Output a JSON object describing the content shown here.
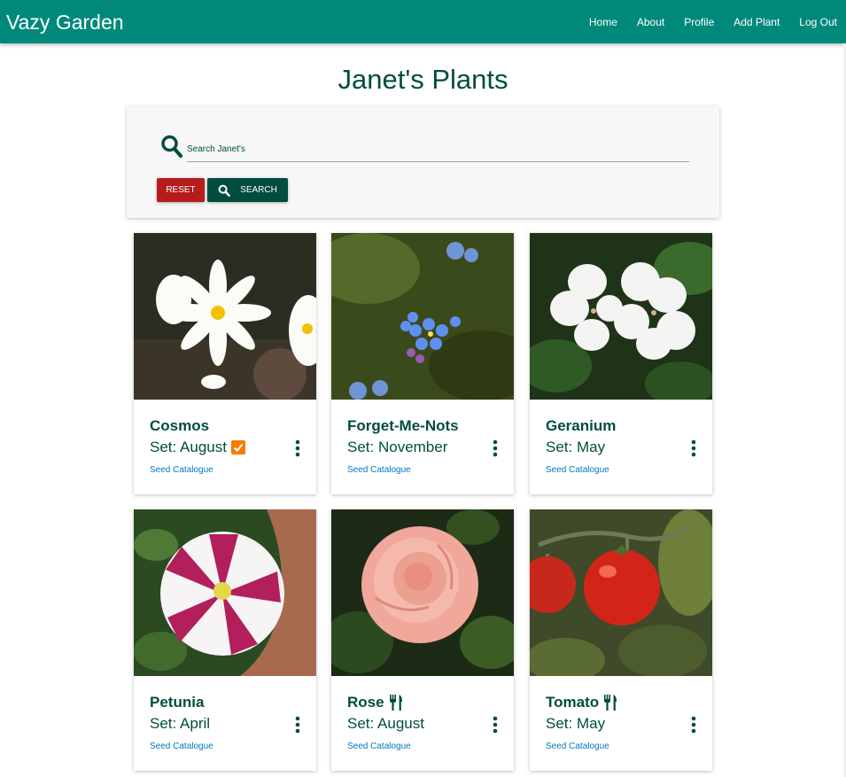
{
  "navbar": {
    "brand": "Vazy Garden",
    "links": [
      "Home",
      "About",
      "Profile",
      "Add Plant",
      "Log Out"
    ],
    "background": "#00897b"
  },
  "page": {
    "title": "Janet's Plants"
  },
  "search": {
    "placeholder": "Search Janet's",
    "value": "",
    "reset_label": "Reset",
    "search_label": "Search"
  },
  "colors": {
    "primary_dark": "#004d40",
    "danger": "#b71c1c",
    "link": "#0277bd",
    "check_accent": "#f57c00"
  },
  "plants": [
    {
      "name": "Cosmos",
      "set": "Set: August",
      "checked": true,
      "edible": false,
      "link": "Seed Catalogue",
      "image": "white-cosmos-flowers"
    },
    {
      "name": "Forget-Me-Nots",
      "set": "Set: November",
      "checked": false,
      "edible": false,
      "link": "Seed Catalogue",
      "image": "blue-forget-me-not-flowers"
    },
    {
      "name": "Geranium",
      "set": "Set: May",
      "checked": false,
      "edible": false,
      "link": "Seed Catalogue",
      "image": "white-geranium-flowers"
    },
    {
      "name": "Petunia",
      "set": "Set: April",
      "checked": false,
      "edible": false,
      "link": "Seed Catalogue",
      "image": "pink-white-petunia-flower"
    },
    {
      "name": "Rose",
      "set": "Set: August",
      "checked": false,
      "edible": true,
      "link": "Seed Catalogue",
      "image": "peach-rose-flower"
    },
    {
      "name": "Tomato",
      "set": "Set: May",
      "checked": false,
      "edible": true,
      "link": "Seed Catalogue",
      "image": "red-tomatoes-on-vine"
    }
  ]
}
